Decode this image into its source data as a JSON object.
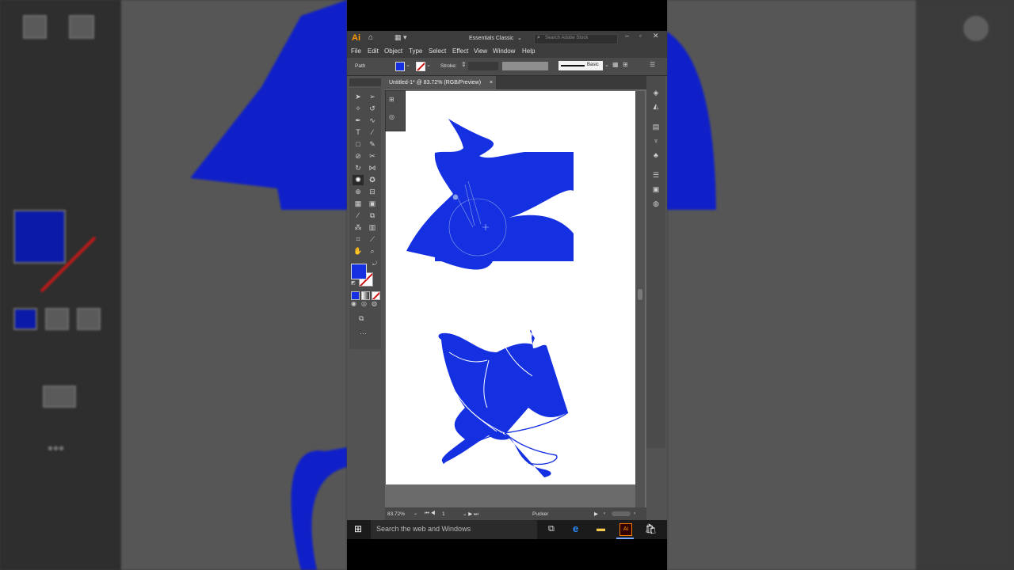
{
  "app": {
    "logo": "Ai",
    "workspace": "Essentials Classic",
    "search_placeholder": "Search Adobe Stock"
  },
  "menu": [
    "File",
    "Edit",
    "Object",
    "Type",
    "Select",
    "Effect",
    "View",
    "Window",
    "Help"
  ],
  "control_bar": {
    "selection_type": "Path",
    "stroke_label": "Stroke:",
    "brush_label": "Basic"
  },
  "document": {
    "tab_title": "Untitled-1* @ 83.72% (RGB/Preview)",
    "close_glyph": "×"
  },
  "status_bar": {
    "zoom": "83.72%",
    "artboard_number": "1",
    "tool_name": "Pucker"
  },
  "taskbar": {
    "search_placeholder": "Search the web and Windows"
  },
  "colors": {
    "fill": "#1530e0",
    "shape": "#1530e0",
    "backdrop_shape": "#1020c8",
    "ui_dark": "#3c3c3c",
    "ui_panel": "#535353"
  },
  "icons": {
    "toolbox": [
      "selection-icon",
      "direct-selection-icon",
      "magic-wand-icon",
      "lasso-icon",
      "pen-icon",
      "curvature-icon",
      "type-icon",
      "line-icon",
      "rectangle-icon",
      "paintbrush-icon",
      "shaper-icon",
      "scissors-icon",
      "rotate-icon",
      "width-icon",
      "pucker-icon",
      "puppet-warp-icon",
      "shape-builder-icon",
      "perspective-icon",
      "mesh-icon",
      "gradient-icon",
      "eyedropper-icon",
      "blend-icon",
      "symbol-sprayer-icon",
      "graph-icon",
      "artboard-icon",
      "slice-icon",
      "hand-icon",
      "zoom-icon"
    ]
  }
}
